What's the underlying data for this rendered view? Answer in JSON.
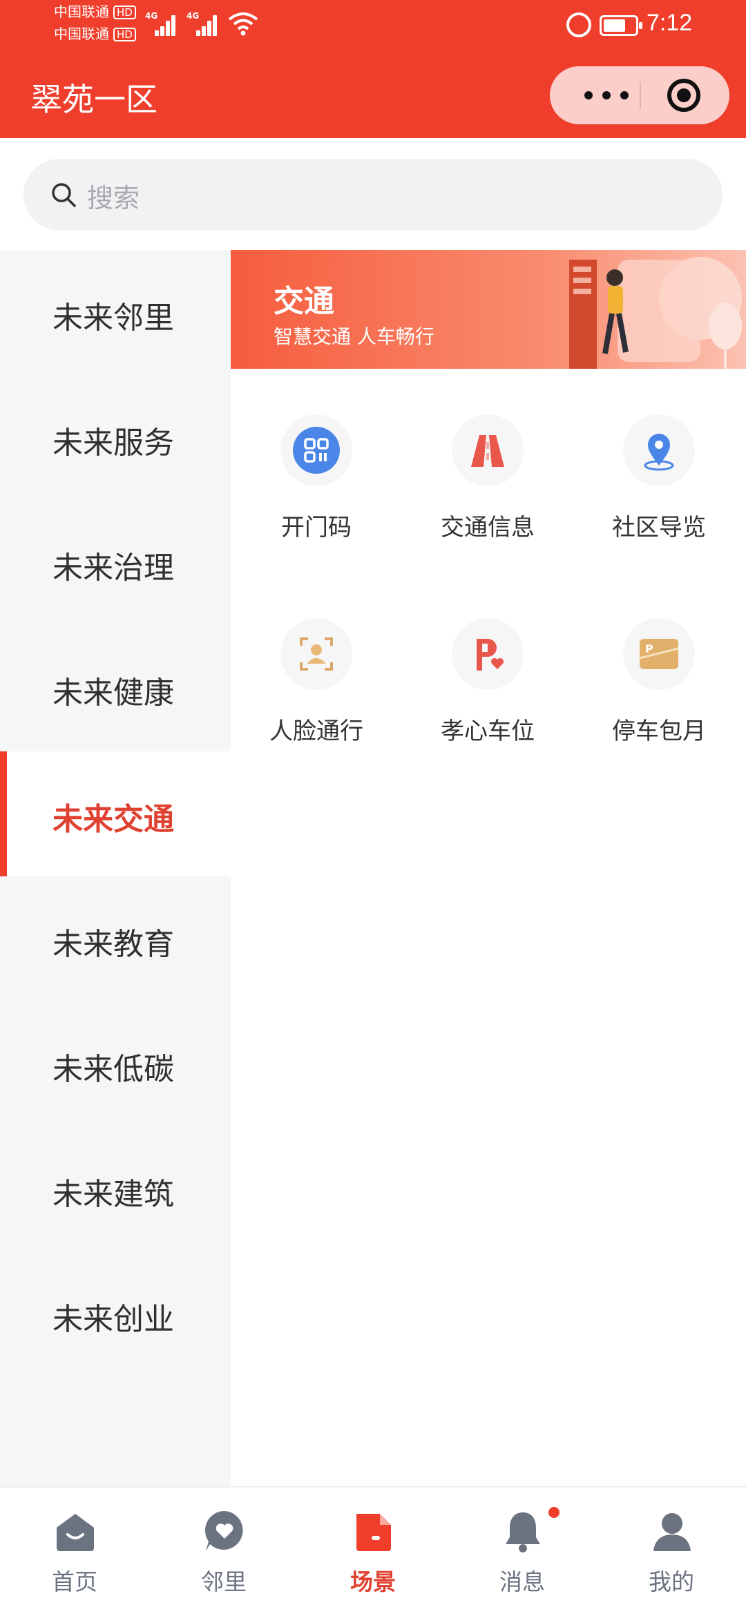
{
  "status_bar": {
    "carrier_1": "中国联通",
    "carrier_2": "中国联通",
    "hd": "HD",
    "network": "4G",
    "time": "7:12",
    "battery_level": 0.7
  },
  "header": {
    "title": "翠苑一区"
  },
  "search": {
    "placeholder": "搜索"
  },
  "sidebar": {
    "items": [
      {
        "label": "未来邻里",
        "active": false
      },
      {
        "label": "未来服务",
        "active": false
      },
      {
        "label": "未来治理",
        "active": false
      },
      {
        "label": "未来健康",
        "active": false
      },
      {
        "label": "未来交通",
        "active": true
      },
      {
        "label": "未来教育",
        "active": false
      },
      {
        "label": "未来低碳",
        "active": false
      },
      {
        "label": "未来建筑",
        "active": false
      },
      {
        "label": "未来创业",
        "active": false
      }
    ]
  },
  "banner": {
    "title": "交通",
    "subtitle": "智慧交通 人车畅行"
  },
  "grid": {
    "items": [
      {
        "label": "开门码",
        "icon": "qr-code-icon"
      },
      {
        "label": "交通信息",
        "icon": "road-icon"
      },
      {
        "label": "社区导览",
        "icon": "location-pin-icon"
      },
      {
        "label": "人脸通行",
        "icon": "face-scan-icon"
      },
      {
        "label": "孝心车位",
        "icon": "parking-heart-icon"
      },
      {
        "label": "停车包月",
        "icon": "parking-card-icon"
      }
    ]
  },
  "tabbar": {
    "items": [
      {
        "label": "首页",
        "icon": "home-icon",
        "active": false
      },
      {
        "label": "邻里",
        "icon": "heart-bubble-icon",
        "active": false
      },
      {
        "label": "场景",
        "icon": "scene-icon",
        "active": true
      },
      {
        "label": "消息",
        "icon": "bell-icon",
        "active": false,
        "badge": true
      },
      {
        "label": "我的",
        "icon": "user-icon",
        "active": false
      }
    ]
  },
  "colors": {
    "brand": "#EF3E2C",
    "active_text": "#E0402F",
    "sidebar_bg": "#F5F6F8",
    "tab_inactive": "#6B7280"
  }
}
